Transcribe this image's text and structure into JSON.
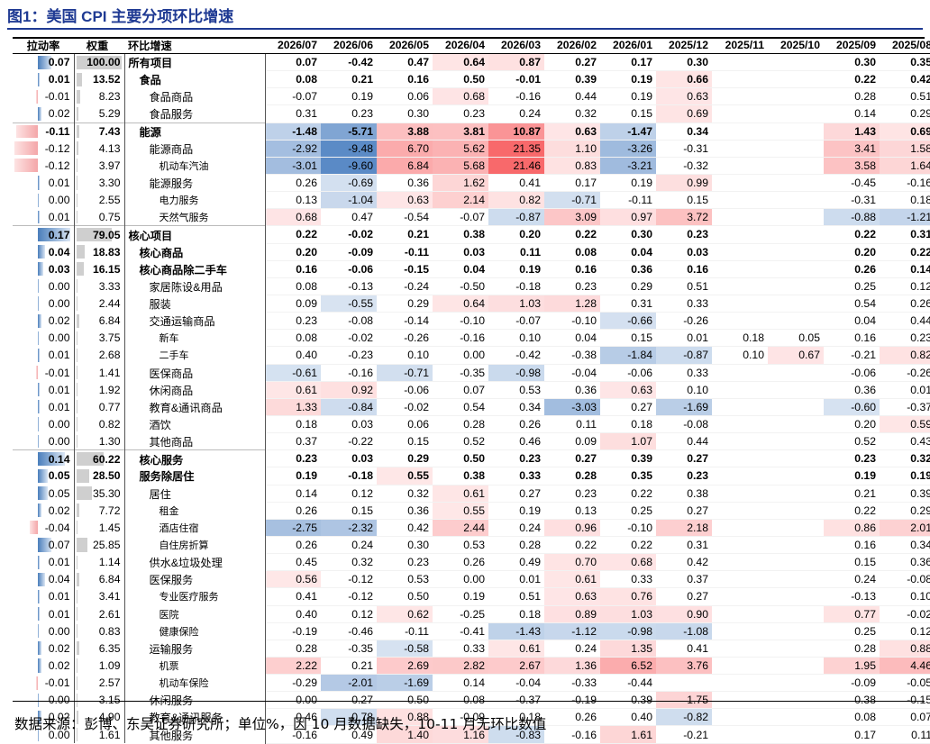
{
  "title": "图1：美国 CPI 主要分项环比增速",
  "footer": "数据来源：彭博、东吴证券研究所；单位%，因 10 月数据缺失，10-11 月无环比数值",
  "colors": {
    "title": "#1f3a93",
    "pos_max": "#f8696b",
    "neg_max": "#5a8ac6",
    "lr_pos": "#4a7ebb",
    "lr_neg": "#f4a6a8",
    "weight_bar": "#cfcfcf"
  },
  "chart_data": {
    "type": "table",
    "headers": {
      "lr": "拉动率",
      "weight": "权重",
      "name": "环比增速",
      "months": [
        "2026/07",
        "2026/06",
        "2026/05",
        "2026/04",
        "2026/03",
        "2026/02",
        "2026/01",
        "2025/12",
        "2025/11",
        "2025/10",
        "2025/09",
        "2025/08"
      ]
    },
    "rows": [
      {
        "lr": "0.07",
        "w": "100.00",
        "name": "所有项目",
        "lvl": 0,
        "bold": true,
        "vals": [
          "0.07",
          "-0.42",
          "0.47",
          "0.64",
          "0.87",
          "0.27",
          "0.17",
          "0.30",
          "",
          "",
          "0.30",
          "0.35"
        ]
      },
      {
        "lr": "0.01",
        "w": "13.52",
        "name": "食品",
        "lvl": 1,
        "bold": true,
        "vals": [
          "0.08",
          "0.21",
          "0.16",
          "0.50",
          "-0.01",
          "0.39",
          "0.19",
          "0.66",
          "",
          "",
          "0.22",
          "0.42"
        ]
      },
      {
        "lr": "-0.01",
        "w": "8.23",
        "name": "食品商品",
        "lvl": 2,
        "bold": false,
        "vals": [
          "-0.07",
          "0.19",
          "0.06",
          "0.68",
          "-0.16",
          "0.44",
          "0.19",
          "0.63",
          "",
          "",
          "0.28",
          "0.51"
        ]
      },
      {
        "lr": "0.02",
        "w": "5.29",
        "name": "食品服务",
        "lvl": 2,
        "bold": false,
        "vals": [
          "0.31",
          "0.23",
          "0.30",
          "0.23",
          "0.24",
          "0.32",
          "0.15",
          "0.69",
          "",
          "",
          "0.14",
          "0.29"
        ]
      },
      {
        "lr": "-0.11",
        "w": "7.43",
        "name": "能源",
        "lvl": 1,
        "bold": true,
        "vals": [
          "-1.48",
          "-5.71",
          "3.88",
          "3.81",
          "10.87",
          "0.63",
          "-1.47",
          "0.34",
          "",
          "",
          "1.43",
          "0.69"
        ]
      },
      {
        "lr": "-0.12",
        "w": "4.13",
        "name": "能源商品",
        "lvl": 2,
        "bold": false,
        "vals": [
          "-2.92",
          "-9.48",
          "6.70",
          "5.62",
          "21.35",
          "1.10",
          "-3.26",
          "-0.31",
          "",
          "",
          "3.41",
          "1.58"
        ]
      },
      {
        "lr": "-0.12",
        "w": "3.97",
        "name": "机动车汽油",
        "lvl": 3,
        "bold": false,
        "vals": [
          "-3.01",
          "-9.60",
          "6.84",
          "5.68",
          "21.46",
          "0.83",
          "-3.21",
          "-0.32",
          "",
          "",
          "3.58",
          "1.64"
        ]
      },
      {
        "lr": "0.01",
        "w": "3.30",
        "name": "能源服务",
        "lvl": 2,
        "bold": false,
        "vals": [
          "0.26",
          "-0.69",
          "0.36",
          "1.62",
          "0.41",
          "0.17",
          "0.19",
          "0.99",
          "",
          "",
          "-0.45",
          "-0.16"
        ]
      },
      {
        "lr": "0.00",
        "w": "2.55",
        "name": "电力服务",
        "lvl": 3,
        "bold": false,
        "vals": [
          "0.13",
          "-1.04",
          "0.63",
          "2.14",
          "0.82",
          "-0.71",
          "-0.11",
          "0.15",
          "",
          "",
          "-0.31",
          "0.18"
        ]
      },
      {
        "lr": "0.01",
        "w": "0.75",
        "name": "天然气服务",
        "lvl": 3,
        "bold": false,
        "vals": [
          "0.68",
          "0.47",
          "-0.54",
          "-0.07",
          "-0.87",
          "3.09",
          "0.97",
          "3.72",
          "",
          "",
          "-0.88",
          "-1.21"
        ]
      },
      {
        "lr": "0.17",
        "w": "79.05",
        "name": "核心项目",
        "lvl": 0,
        "bold": true,
        "vals": [
          "0.22",
          "-0.02",
          "0.21",
          "0.38",
          "0.20",
          "0.22",
          "0.30",
          "0.23",
          "",
          "",
          "0.22",
          "0.31"
        ]
      },
      {
        "lr": "0.04",
        "w": "18.83",
        "name": "核心商品",
        "lvl": 1,
        "bold": true,
        "vals": [
          "0.20",
          "-0.09",
          "-0.11",
          "0.03",
          "0.11",
          "0.08",
          "0.04",
          "0.03",
          "",
          "",
          "0.20",
          "0.22"
        ]
      },
      {
        "lr": "0.03",
        "w": "16.15",
        "name": "核心商品除二手车",
        "lvl": 1,
        "bold": true,
        "vals": [
          "0.16",
          "-0.06",
          "-0.15",
          "0.04",
          "0.19",
          "0.16",
          "0.36",
          "0.16",
          "",
          "",
          "0.26",
          "0.14"
        ]
      },
      {
        "lr": "0.00",
        "w": "3.33",
        "name": "家居陈设&用品",
        "lvl": 2,
        "bold": false,
        "vals": [
          "0.08",
          "-0.13",
          "-0.24",
          "-0.50",
          "-0.18",
          "0.23",
          "0.29",
          "0.51",
          "",
          "",
          "0.25",
          "0.12"
        ]
      },
      {
        "lr": "0.00",
        "w": "2.44",
        "name": "服装",
        "lvl": 2,
        "bold": false,
        "vals": [
          "0.09",
          "-0.55",
          "0.29",
          "0.64",
          "1.03",
          "1.28",
          "0.31",
          "0.33",
          "",
          "",
          "0.54",
          "0.26"
        ]
      },
      {
        "lr": "0.02",
        "w": "6.84",
        "name": "交通运输商品",
        "lvl": 2,
        "bold": false,
        "vals": [
          "0.23",
          "-0.08",
          "-0.14",
          "-0.10",
          "-0.07",
          "-0.10",
          "-0.66",
          "-0.26",
          "",
          "",
          "0.04",
          "0.44"
        ]
      },
      {
        "lr": "0.00",
        "w": "3.75",
        "name": "新车",
        "lvl": 3,
        "bold": false,
        "vals": [
          "0.08",
          "-0.02",
          "-0.26",
          "-0.16",
          "0.10",
          "0.04",
          "0.15",
          "0.01",
          "0.18",
          "0.05",
          "0.16",
          "0.23"
        ]
      },
      {
        "lr": "0.01",
        "w": "2.68",
        "name": "二手车",
        "lvl": 3,
        "bold": false,
        "vals": [
          "0.40",
          "-0.23",
          "0.10",
          "0.00",
          "-0.42",
          "-0.38",
          "-1.84",
          "-0.87",
          "0.10",
          "0.67",
          "-0.21",
          "0.82"
        ]
      },
      {
        "lr": "-0.01",
        "w": "1.41",
        "name": "医保商品",
        "lvl": 2,
        "bold": false,
        "vals": [
          "-0.61",
          "-0.16",
          "-0.71",
          "-0.35",
          "-0.98",
          "-0.04",
          "-0.06",
          "0.33",
          "",
          "",
          "-0.06",
          "-0.26"
        ]
      },
      {
        "lr": "0.01",
        "w": "1.92",
        "name": "休闲商品",
        "lvl": 2,
        "bold": false,
        "vals": [
          "0.61",
          "0.92",
          "-0.06",
          "0.07",
          "0.53",
          "0.36",
          "0.63",
          "0.10",
          "",
          "",
          "0.36",
          "0.01"
        ]
      },
      {
        "lr": "0.01",
        "w": "0.77",
        "name": "教育&通讯商品",
        "lvl": 2,
        "bold": false,
        "vals": [
          "1.33",
          "-0.84",
          "-0.02",
          "0.54",
          "0.34",
          "-3.03",
          "0.27",
          "-1.69",
          "",
          "",
          "-0.60",
          "-0.37"
        ]
      },
      {
        "lr": "0.00",
        "w": "0.82",
        "name": "酒饮",
        "lvl": 2,
        "bold": false,
        "vals": [
          "0.18",
          "0.03",
          "0.06",
          "0.28",
          "0.26",
          "0.11",
          "0.18",
          "-0.08",
          "",
          "",
          "0.20",
          "0.59"
        ]
      },
      {
        "lr": "0.00",
        "w": "1.30",
        "name": "其他商品",
        "lvl": 2,
        "bold": false,
        "vals": [
          "0.37",
          "-0.22",
          "0.15",
          "0.52",
          "0.46",
          "0.09",
          "1.07",
          "0.44",
          "",
          "",
          "0.52",
          "0.43"
        ]
      },
      {
        "lr": "0.14",
        "w": "60.22",
        "name": "核心服务",
        "lvl": 1,
        "bold": true,
        "vals": [
          "0.23",
          "0.03",
          "0.29",
          "0.50",
          "0.23",
          "0.27",
          "0.39",
          "0.27",
          "",
          "",
          "0.23",
          "0.32"
        ]
      },
      {
        "lr": "0.05",
        "w": "28.50",
        "name": "服务除居住",
        "lvl": 1,
        "bold": true,
        "vals": [
          "0.19",
          "-0.18",
          "0.55",
          "0.38",
          "0.33",
          "0.28",
          "0.35",
          "0.23",
          "",
          "",
          "0.19",
          "0.19"
        ]
      },
      {
        "lr": "0.05",
        "w": "35.30",
        "name": "居住",
        "lvl": 2,
        "bold": false,
        "vals": [
          "0.14",
          "0.12",
          "0.32",
          "0.61",
          "0.27",
          "0.23",
          "0.22",
          "0.38",
          "",
          "",
          "0.21",
          "0.39"
        ]
      },
      {
        "lr": "0.02",
        "w": "7.72",
        "name": "租金",
        "lvl": 3,
        "bold": false,
        "vals": [
          "0.26",
          "0.15",
          "0.36",
          "0.55",
          "0.19",
          "0.13",
          "0.25",
          "0.27",
          "",
          "",
          "0.22",
          "0.29"
        ]
      },
      {
        "lr": "-0.04",
        "w": "1.45",
        "name": "酒店住宿",
        "lvl": 3,
        "bold": false,
        "vals": [
          "-2.75",
          "-2.32",
          "0.42",
          "2.44",
          "0.24",
          "0.96",
          "-0.10",
          "2.18",
          "",
          "",
          "0.86",
          "2.01"
        ]
      },
      {
        "lr": "0.07",
        "w": "25.85",
        "name": "自住房折算",
        "lvl": 3,
        "bold": false,
        "vals": [
          "0.26",
          "0.24",
          "0.30",
          "0.53",
          "0.28",
          "0.22",
          "0.22",
          "0.31",
          "",
          "",
          "0.16",
          "0.34"
        ]
      },
      {
        "lr": "0.01",
        "w": "1.14",
        "name": "供水&垃圾处理",
        "lvl": 2,
        "bold": false,
        "vals": [
          "0.45",
          "0.32",
          "0.23",
          "0.26",
          "0.49",
          "0.70",
          "0.68",
          "0.42",
          "",
          "",
          "0.15",
          "0.36"
        ]
      },
      {
        "lr": "0.04",
        "w": "6.84",
        "name": "医保服务",
        "lvl": 2,
        "bold": false,
        "vals": [
          "0.56",
          "-0.12",
          "0.53",
          "0.00",
          "0.01",
          "0.61",
          "0.33",
          "0.37",
          "",
          "",
          "0.24",
          "-0.08"
        ]
      },
      {
        "lr": "0.01",
        "w": "3.41",
        "name": "专业医疗服务",
        "lvl": 3,
        "bold": false,
        "vals": [
          "0.41",
          "-0.12",
          "0.50",
          "0.19",
          "0.51",
          "0.63",
          "0.76",
          "0.27",
          "",
          "",
          "-0.13",
          "0.10"
        ]
      },
      {
        "lr": "0.01",
        "w": "2.61",
        "name": "医院",
        "lvl": 3,
        "bold": false,
        "vals": [
          "0.40",
          "0.12",
          "0.62",
          "-0.25",
          "0.18",
          "0.89",
          "1.03",
          "0.90",
          "",
          "",
          "0.77",
          "-0.02"
        ]
      },
      {
        "lr": "0.00",
        "w": "0.83",
        "name": "健康保险",
        "lvl": 3,
        "bold": false,
        "vals": [
          "-0.19",
          "-0.46",
          "-0.11",
          "-0.41",
          "-1.43",
          "-1.12",
          "-0.98",
          "-1.08",
          "",
          "",
          "0.25",
          "0.12"
        ]
      },
      {
        "lr": "0.02",
        "w": "6.35",
        "name": "运输服务",
        "lvl": 2,
        "bold": false,
        "vals": [
          "0.28",
          "-0.35",
          "-0.58",
          "0.33",
          "0.61",
          "0.24",
          "1.35",
          "0.41",
          "",
          "",
          "0.28",
          "0.88"
        ]
      },
      {
        "lr": "0.02",
        "w": "1.09",
        "name": "机票",
        "lvl": 3,
        "bold": false,
        "vals": [
          "2.22",
          "0.21",
          "2.69",
          "2.82",
          "2.67",
          "1.36",
          "6.52",
          "3.76",
          "",
          "",
          "1.95",
          "4.46"
        ]
      },
      {
        "lr": "-0.01",
        "w": "2.57",
        "name": "机动车保险",
        "lvl": 3,
        "bold": false,
        "vals": [
          "-0.29",
          "-2.01",
          "-1.69",
          "0.14",
          "-0.04",
          "-0.33",
          "-0.44",
          "",
          "",
          "",
          "-0.09",
          "-0.05"
        ]
      },
      {
        "lr": "0.00",
        "w": "3.15",
        "name": "休闲服务",
        "lvl": 2,
        "bold": false,
        "vals": [
          "0.00",
          "0.27",
          "0.50",
          "0.08",
          "-0.37",
          "-0.19",
          "0.39",
          "1.75",
          "",
          "",
          "0.38",
          "-0.15"
        ]
      },
      {
        "lr": "0.02",
        "w": "4.90",
        "name": "教育&通讯服务",
        "lvl": 2,
        "bold": false,
        "vals": [
          "0.46",
          "-0.78",
          "0.88",
          "-0.09",
          "0.18",
          "0.26",
          "0.40",
          "-0.82",
          "",
          "",
          "0.08",
          "0.07"
        ]
      },
      {
        "lr": "0.00",
        "w": "1.61",
        "name": "其他服务",
        "lvl": 2,
        "bold": false,
        "vals": [
          "-0.16",
          "0.49",
          "1.40",
          "1.16",
          "-0.83",
          "-0.16",
          "1.61",
          "-0.21",
          "",
          "",
          "0.17",
          "0.11"
        ]
      }
    ]
  }
}
